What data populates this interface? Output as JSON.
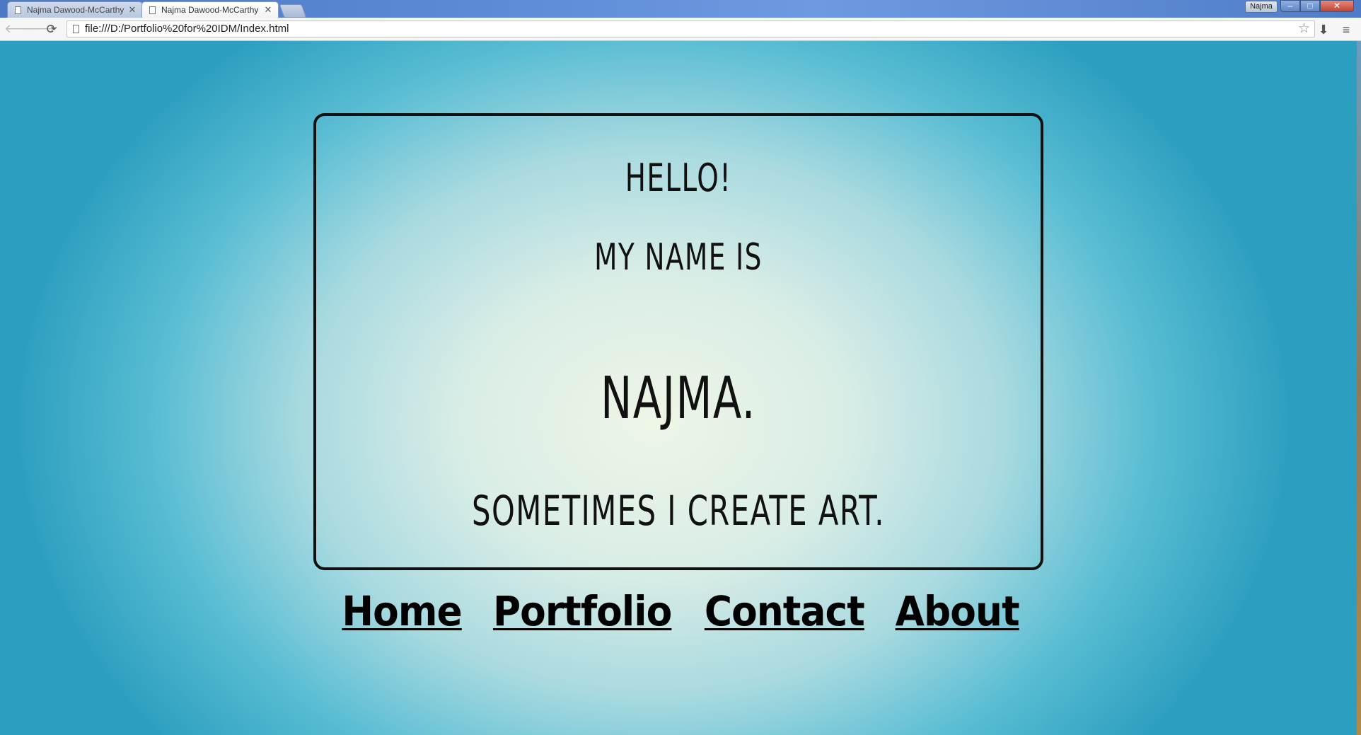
{
  "browser": {
    "tabs": [
      {
        "title": "Najma Dawood-McCarthy",
        "close_glyph": "✕",
        "active": false
      },
      {
        "title": "Najma Dawood-McCarthy",
        "close_glyph": "✕",
        "active": true
      }
    ],
    "profile_name": "Najma",
    "window_controls": {
      "minimize": "–",
      "maximize": "□",
      "close": "✕"
    },
    "address_bar": {
      "url": "file:///D:/Portfolio%20for%20IDM/Index.html"
    },
    "icons": {
      "back": "arrow-left-icon",
      "forward": "arrow-right-icon",
      "reload": "reload-icon",
      "bookmark": "star-icon",
      "download": "download-icon",
      "menu": "hamburger-menu-icon"
    },
    "icon_glyphs": {
      "back": "🡐",
      "forward": "🡒",
      "reload": "⟳",
      "bookmark": "☆",
      "download": "⬇",
      "menu": "≡"
    }
  },
  "page": {
    "greeting": "HELLO!",
    "name_intro": "MY NAME IS",
    "name": "NAJMA.",
    "tagline": "SOMETIMES I CREATE ART.",
    "nav": [
      {
        "label": "Home"
      },
      {
        "label": "Portfolio"
      },
      {
        "label": "Contact"
      },
      {
        "label": "About"
      }
    ]
  },
  "colors": {
    "background_center": "#eef6e6",
    "background_edge": "#2c9fc0",
    "text": "#111111",
    "card_border": "#111111"
  }
}
